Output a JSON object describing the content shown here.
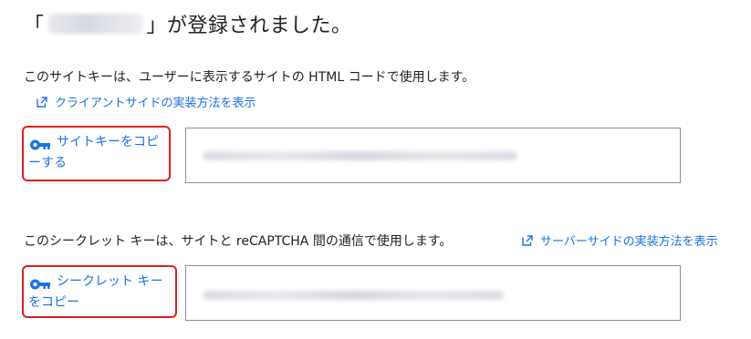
{
  "title": {
    "open_bracket": "「",
    "close_text": "」が登録されました。"
  },
  "site_key": {
    "description": "このサイトキーは、ユーザーに表示するサイトの HTML コードで使用します。",
    "link_label": "クライアントサイドの実装方法を表示",
    "copy_line1": "サイトキーをコピ",
    "copy_line2": "ーする"
  },
  "secret_key": {
    "description": "このシークレット キーは、サイトと reCAPTCHA 間の通信で使用します。",
    "link_label": "サーバーサイドの実装方法を表示",
    "copy_line1": "シークレット キー",
    "copy_line2": "をコピー"
  },
  "icons": {
    "key": "key-icon",
    "external_link": "open-in-new-icon"
  },
  "colors": {
    "link": "#1a73e8",
    "highlight_border": "#e0201c",
    "text": "#202124",
    "input_border": "#8a8f98"
  }
}
